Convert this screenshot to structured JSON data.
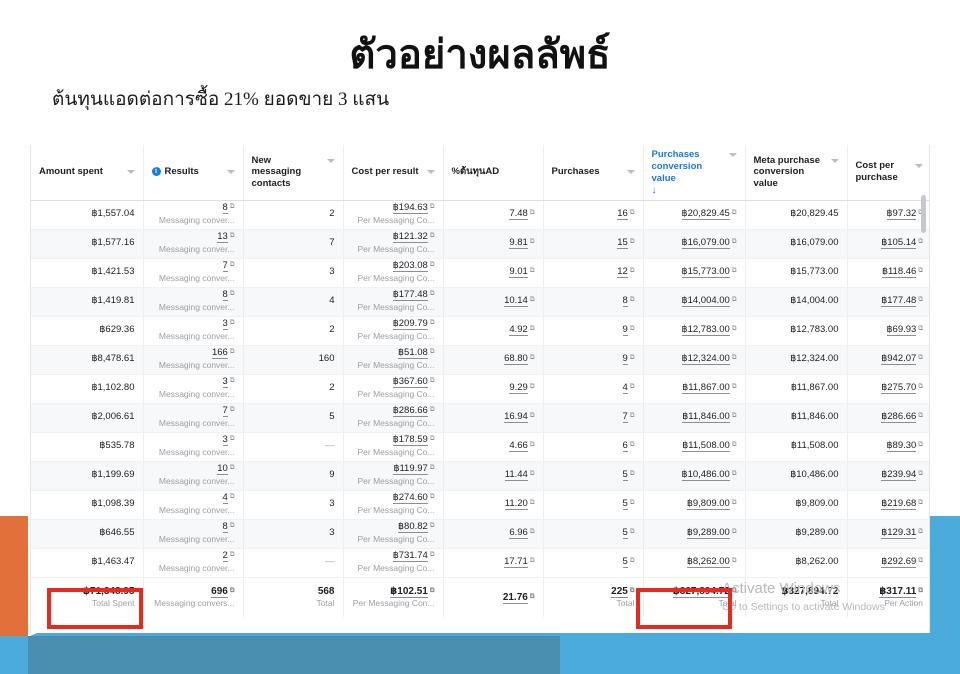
{
  "slide": {
    "title": "ตัวอย่างผลลัพธ์",
    "subtitle": "ต้นทุนแอดต่อการซื้อ 21% ยอดขาย 3 แสน",
    "colors": {
      "orange": "#E2703A",
      "blue_light": "#4BACDC",
      "blue_slate": "#4A8FB0",
      "highlight_red": "#E8291C",
      "link_blue": "#1877F2"
    }
  },
  "watermark": {
    "title": "Activate Windows",
    "subtitle": "Go to Settings to activate Windows"
  },
  "table": {
    "columns": [
      {
        "label": "Amount spent",
        "has_info": false,
        "has_caret": true,
        "sorted": false
      },
      {
        "label": "Results",
        "has_info": true,
        "has_caret": true,
        "sorted": false
      },
      {
        "label": "New messaging contacts",
        "has_info": false,
        "has_caret": true,
        "sorted": false
      },
      {
        "label": "Cost per result",
        "has_info": false,
        "has_caret": true,
        "sorted": false
      },
      {
        "label": "%ต้นทุนAD",
        "has_info": false,
        "has_caret": false,
        "sorted": false
      },
      {
        "label": "Purchases",
        "has_info": false,
        "has_caret": true,
        "sorted": false
      },
      {
        "label": "Purchases conversion value",
        "has_info": false,
        "has_caret": true,
        "sorted": true,
        "sort_arrow": "↓"
      },
      {
        "label": "Meta purchase conversion value",
        "has_info": false,
        "has_caret": true,
        "sorted": false
      },
      {
        "label": "Cost per purchase",
        "has_info": false,
        "has_caret": true,
        "sorted": false
      }
    ],
    "rows": [
      {
        "amount_spent": "฿1,557.04",
        "results": "8",
        "results_sub": "Messaging conver...",
        "new_contacts": "2",
        "cost_per_result": "฿194.63",
        "cost_per_result_sub": "Per Messaging Co...",
        "pct_ad": "7.48",
        "purchases": "16",
        "purchases_conv_value": "฿20,829.45",
        "meta_purchase_conv_value": "฿20,829.45",
        "cost_per_purchase": "฿97.32"
      },
      {
        "amount_spent": "฿1,577.16",
        "results": "13",
        "results_sub": "Messaging conver...",
        "new_contacts": "7",
        "cost_per_result": "฿121.32",
        "cost_per_result_sub": "Per Messaging Co...",
        "pct_ad": "9.81",
        "purchases": "15",
        "purchases_conv_value": "฿16,079.00",
        "meta_purchase_conv_value": "฿16,079.00",
        "cost_per_purchase": "฿105.14"
      },
      {
        "amount_spent": "฿1,421.53",
        "results": "7",
        "results_sub": "Messaging conver...",
        "new_contacts": "3",
        "cost_per_result": "฿203.08",
        "cost_per_result_sub": "Per Messaging Co...",
        "pct_ad": "9.01",
        "purchases": "12",
        "purchases_conv_value": "฿15,773.00",
        "meta_purchase_conv_value": "฿15,773.00",
        "cost_per_purchase": "฿118.46"
      },
      {
        "amount_spent": "฿1,419.81",
        "results": "8",
        "results_sub": "Messaging conver...",
        "new_contacts": "4",
        "cost_per_result": "฿177.48",
        "cost_per_result_sub": "Per Messaging Co...",
        "pct_ad": "10.14",
        "purchases": "8",
        "purchases_conv_value": "฿14,004.00",
        "meta_purchase_conv_value": "฿14,004.00",
        "cost_per_purchase": "฿177.48"
      },
      {
        "amount_spent": "฿629.36",
        "results": "3",
        "results_sub": "Messaging conver...",
        "new_contacts": "2",
        "cost_per_result": "฿209.79",
        "cost_per_result_sub": "Per Messaging Co...",
        "pct_ad": "4.92",
        "purchases": "9",
        "purchases_conv_value": "฿12,783.00",
        "meta_purchase_conv_value": "฿12,783.00",
        "cost_per_purchase": "฿69.93"
      },
      {
        "amount_spent": "฿8,478.61",
        "results": "166",
        "results_sub": "Messaging conver...",
        "new_contacts": "160",
        "cost_per_result": "฿51.08",
        "cost_per_result_sub": "Per Messaging Co...",
        "pct_ad": "68.80",
        "purchases": "9",
        "purchases_conv_value": "฿12,324.00",
        "meta_purchase_conv_value": "฿12,324.00",
        "cost_per_purchase": "฿942.07"
      },
      {
        "amount_spent": "฿1,102.80",
        "results": "3",
        "results_sub": "Messaging conver...",
        "new_contacts": "2",
        "cost_per_result": "฿367.60",
        "cost_per_result_sub": "Per Messaging Co...",
        "pct_ad": "9.29",
        "purchases": "4",
        "purchases_conv_value": "฿11,867.00",
        "meta_purchase_conv_value": "฿11,867.00",
        "cost_per_purchase": "฿275.70"
      },
      {
        "amount_spent": "฿2,006.61",
        "results": "7",
        "results_sub": "Messaging conver...",
        "new_contacts": "5",
        "cost_per_result": "฿286.66",
        "cost_per_result_sub": "Per Messaging Co...",
        "pct_ad": "16.94",
        "purchases": "7",
        "purchases_conv_value": "฿11,846.00",
        "meta_purchase_conv_value": "฿11,846.00",
        "cost_per_purchase": "฿286.66"
      },
      {
        "amount_spent": "฿535.78",
        "results": "3",
        "results_sub": "Messaging conver...",
        "new_contacts": "—",
        "cost_per_result": "฿178.59",
        "cost_per_result_sub": "Per Messaging Co...",
        "pct_ad": "4.66",
        "purchases": "6",
        "purchases_conv_value": "฿11,508.00",
        "meta_purchase_conv_value": "฿11,508.00",
        "cost_per_purchase": "฿89.30"
      },
      {
        "amount_spent": "฿1,199.69",
        "results": "10",
        "results_sub": "Messaging conver...",
        "new_contacts": "9",
        "cost_per_result": "฿119.97",
        "cost_per_result_sub": "Per Messaging Co...",
        "pct_ad": "11.44",
        "purchases": "5",
        "purchases_conv_value": "฿10,486.00",
        "meta_purchase_conv_value": "฿10,486.00",
        "cost_per_purchase": "฿239.94"
      },
      {
        "amount_spent": "฿1,098.39",
        "results": "4",
        "results_sub": "Messaging conver...",
        "new_contacts": "3",
        "cost_per_result": "฿274.60",
        "cost_per_result_sub": "Per Messaging Co...",
        "pct_ad": "11.20",
        "purchases": "5",
        "purchases_conv_value": "฿9,809.00",
        "meta_purchase_conv_value": "฿9,809.00",
        "cost_per_purchase": "฿219.68"
      },
      {
        "amount_spent": "฿646.55",
        "results": "8",
        "results_sub": "Messaging conver...",
        "new_contacts": "3",
        "cost_per_result": "฿80.82",
        "cost_per_result_sub": "Per Messaging Co...",
        "pct_ad": "6.96",
        "purchases": "5",
        "purchases_conv_value": "฿9,289.00",
        "meta_purchase_conv_value": "฿9,289.00",
        "cost_per_purchase": "฿129.31"
      },
      {
        "amount_spent": "฿1,463.47",
        "results": "2",
        "results_sub": "Messaging conver...",
        "new_contacts": "—",
        "cost_per_result": "฿731.74",
        "cost_per_result_sub": "Per Messaging Co...",
        "pct_ad": "17.71",
        "purchases": "5",
        "purchases_conv_value": "฿8,262.00",
        "meta_purchase_conv_value": "฿8,262.00",
        "cost_per_purchase": "฿292.69"
      }
    ],
    "totals": {
      "amount_spent": "฿71,348.95",
      "amount_spent_sub": "Total Spent",
      "results": "696",
      "results_sub": "Messaging convers...",
      "new_contacts": "568",
      "new_contacts_sub": "Total",
      "cost_per_result": "฿102.51",
      "cost_per_result_sub": "Per Messaging Con...",
      "pct_ad": "21.76",
      "pct_ad_sub": "",
      "purchases": "225",
      "purchases_sub": "Total",
      "purchases_conv_value": "฿327,894.72",
      "purchases_conv_value_sub": "Total",
      "meta_purchase_conv_value": "฿327,894.72",
      "meta_purchase_conv_value_sub": "Total",
      "cost_per_purchase": "฿317.11",
      "cost_per_purchase_sub": "Per Action"
    }
  }
}
